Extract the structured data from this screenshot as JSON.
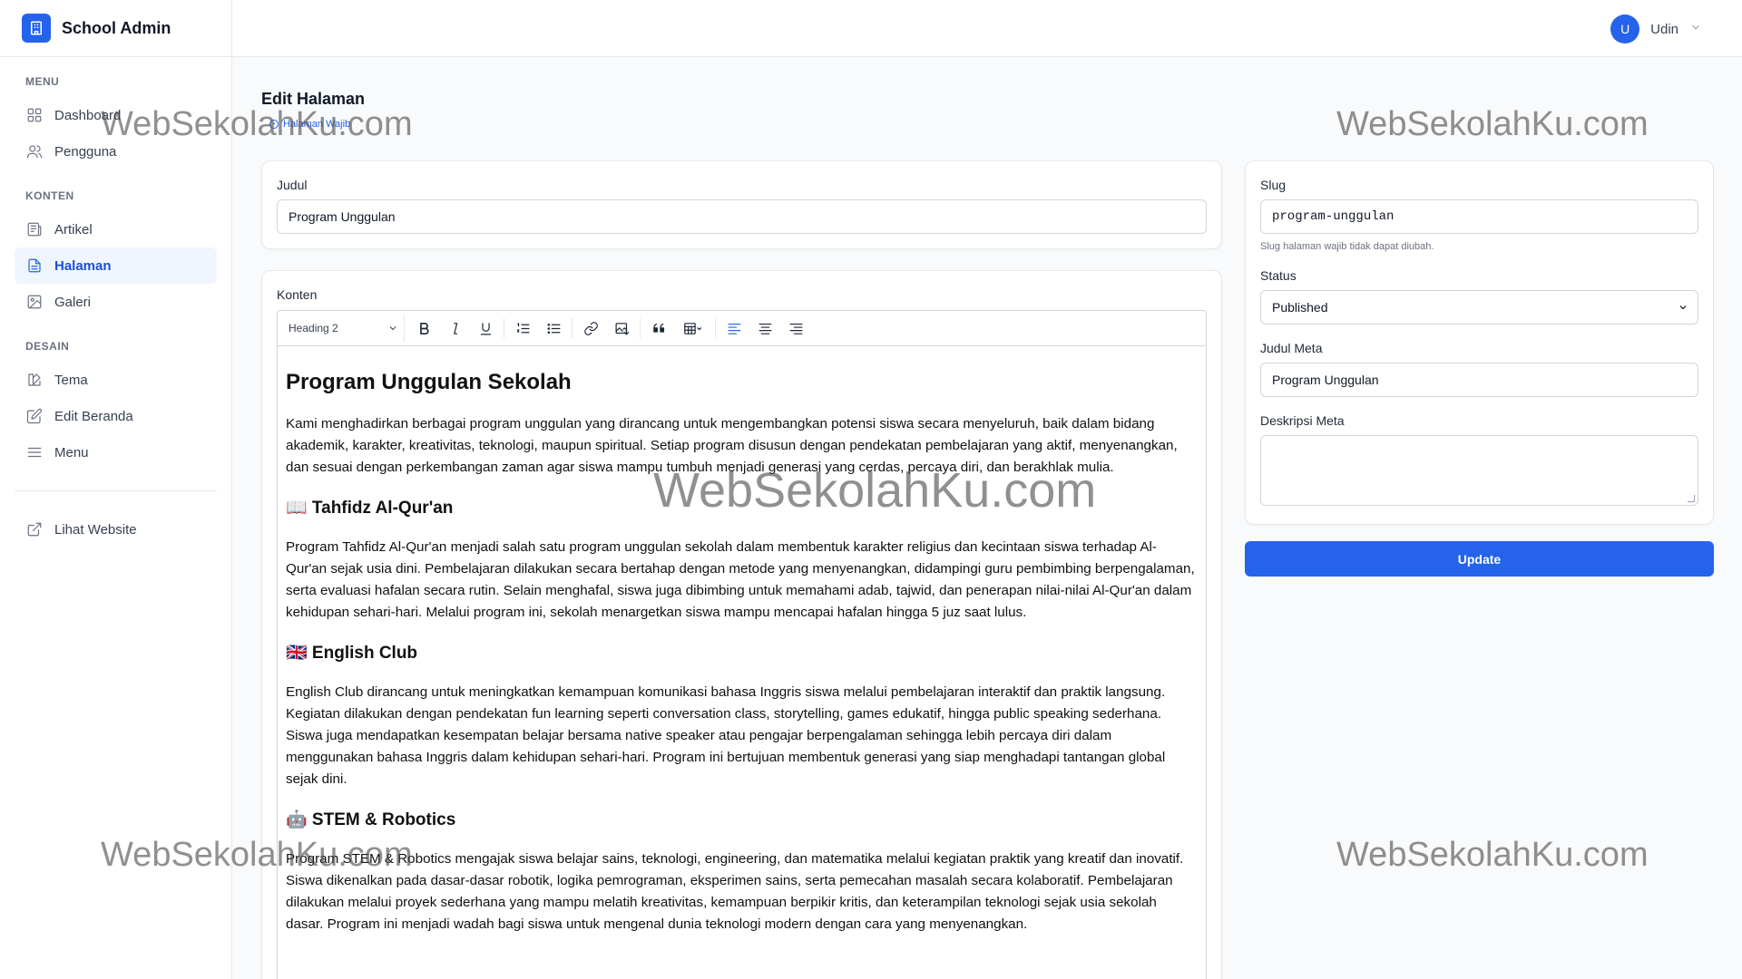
{
  "brand": {
    "title": "School Admin"
  },
  "sidebar": {
    "sections": [
      {
        "title": "MENU",
        "items": [
          {
            "label": "Dashboard"
          },
          {
            "label": "Pengguna"
          }
        ]
      },
      {
        "title": "KONTEN",
        "items": [
          {
            "label": "Artikel"
          },
          {
            "label": "Halaman",
            "active": true
          },
          {
            "label": "Galeri"
          }
        ]
      },
      {
        "title": "DESAIN",
        "items": [
          {
            "label": "Tema"
          },
          {
            "label": "Edit Beranda"
          },
          {
            "label": "Menu"
          }
        ]
      }
    ],
    "footer_link": "Lihat Website"
  },
  "user": {
    "initial": "U",
    "name": "Udin"
  },
  "page": {
    "title": "Edit Halaman",
    "badge": "Halaman Wajib"
  },
  "form": {
    "title_label": "Judul",
    "title_value": "Program Unggulan",
    "content_label": "Konten",
    "toolbar": {
      "heading_select": "Heading 2"
    }
  },
  "content": {
    "heading": "Program Unggulan Sekolah",
    "intro": "Kami menghadirkan berbagai program unggulan yang dirancang untuk mengembangkan potensi siswa secara menyeluruh, baik dalam bidang akademik, karakter, kreativitas, teknologi, maupun spiritual. Setiap program disusun dengan pendekatan pembelajaran yang aktif, menyenangkan, dan sesuai dengan perkembangan zaman agar siswa mampu tumbuh menjadi generasi yang cerdas, percaya diri, dan berakhlak mulia.",
    "sections": [
      {
        "title": "📖 Tahfidz Al-Qur'an",
        "body": "Program Tahfidz Al-Qur'an menjadi salah satu program unggulan sekolah dalam membentuk karakter religius dan kecintaan siswa terhadap Al-Qur'an sejak usia dini. Pembelajaran dilakukan secara bertahap dengan metode yang menyenangkan, didampingi guru pembimbing berpengalaman, serta evaluasi hafalan secara rutin. Selain menghafal, siswa juga dibimbing untuk memahami adab, tajwid, dan penerapan nilai-nilai Al-Qur'an dalam kehidupan sehari-hari. Melalui program ini, sekolah menargetkan siswa mampu mencapai hafalan hingga 5 juz saat lulus."
      },
      {
        "title": "🇬🇧 English Club",
        "body": "English Club dirancang untuk meningkatkan kemampuan komunikasi bahasa Inggris siswa melalui pembelajaran interaktif dan praktik langsung. Kegiatan dilakukan dengan pendekatan fun learning seperti conversation class, storytelling, games edukatif, hingga public speaking sederhana. Siswa juga mendapatkan kesempatan belajar bersama native speaker atau pengajar berpengalaman sehingga lebih percaya diri dalam menggunakan bahasa Inggris dalam kehidupan sehari-hari. Program ini bertujuan membentuk generasi yang siap menghadapi tantangan global sejak dini."
      },
      {
        "title": "🤖 STEM & Robotics",
        "body": "Program STEM & Robotics mengajak siswa belajar sains, teknologi, engineering, dan matematika melalui kegiatan praktik yang kreatif dan inovatif. Siswa dikenalkan pada dasar-dasar robotik, logika pemrograman, eksperimen sains, serta pemecahan masalah secara kolaboratif. Pembelajaran dilakukan melalui proyek sederhana yang mampu melatih kreativitas, kemampuan berpikir kritis, dan keterampilan teknologi sejak usia sekolah dasar. Program ini menjadi wadah bagi siswa untuk mengenal dunia teknologi modern dengan cara yang menyenangkan."
      }
    ]
  },
  "side": {
    "slug_label": "Slug",
    "slug_value": "program-unggulan",
    "slug_help": "Slug halaman wajib tidak dapat diubah.",
    "status_label": "Status",
    "status_value": "Published",
    "meta_title_label": "Judul Meta",
    "meta_title_value": "Program Unggulan",
    "meta_desc_label": "Deskripsi Meta",
    "meta_desc_value": ""
  },
  "update_button": "Update",
  "watermark": "WebSekolahKu.com",
  "colors": {
    "primary": "#2563eb",
    "active_bg": "#eff6ff"
  }
}
